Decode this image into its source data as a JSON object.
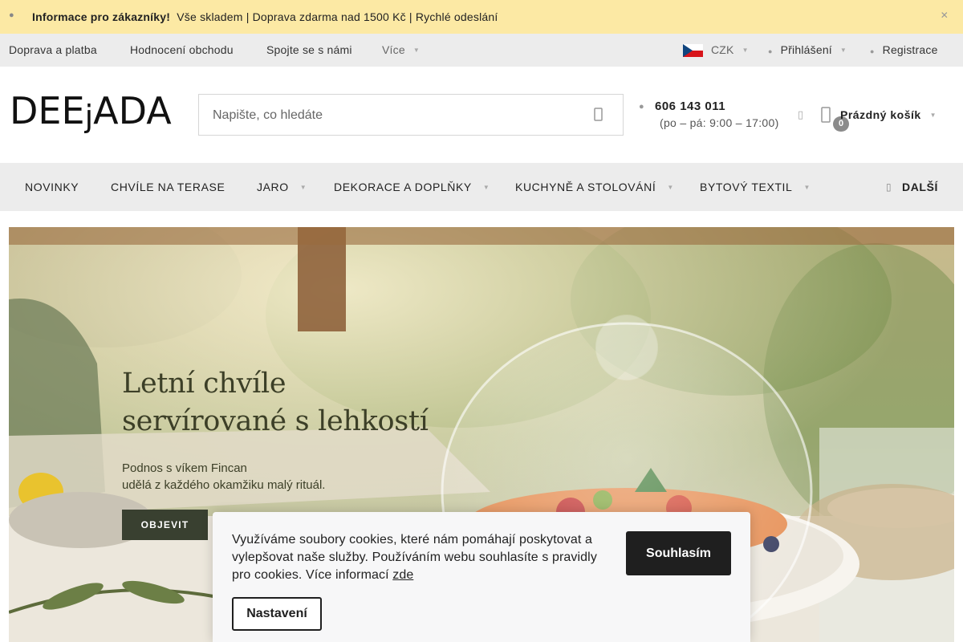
{
  "infobar": {
    "title": "Informace pro zákazníky!",
    "text": "Vše skladem | Doprava zdarma nad 1500 Kč | Rychlé odeslání",
    "info_icon": "info-icon",
    "close_icon": "close-icon"
  },
  "topbar": {
    "links": [
      "Doprava a platba",
      "Hodnocení obchodu",
      "Spojte se s námi"
    ],
    "more": "Více",
    "currency": "CZK",
    "login": "Přihlášení",
    "register": "Registrace"
  },
  "header": {
    "logo": "DEEjADA",
    "search_placeholder": "Napište, co hledáte",
    "phone": "606 143 011",
    "hours": "(po – pá: 9:00 – 17:00)",
    "cart_count": "0",
    "cart_label": "Prázdný košík"
  },
  "mainnav": {
    "items": [
      "NOVINKY",
      "CHVÍLE NA TERASE",
      "JARO",
      "DEKORACE A DOPLŇKY",
      "KUCHYNĚ A STOLOVÁNÍ",
      "BYTOVÝ TEXTIL"
    ],
    "more": "DALŠÍ"
  },
  "hero": {
    "title_line1": "Letní chvíle",
    "title_line2": "servírované s lehkostí",
    "sub_line1": "Podnos s víkem Fincan",
    "sub_line2": "udělá z každého okamžiku malý rituál.",
    "button": "OBJEVIT"
  },
  "cookie": {
    "text": "Využíváme soubory cookies, které nám pomáhají poskytovat a vylepšovat naše služby. Používáním webu souhlasíte s pravidly pro cookies. Více informací",
    "link": "zde",
    "agree": "Souhlasím",
    "settings": "Nastavení"
  },
  "colors": {
    "infobar": "#fce9a4",
    "topbar": "#ececec",
    "hero_button": "#394030",
    "cookie_button": "#1f1f1f"
  }
}
